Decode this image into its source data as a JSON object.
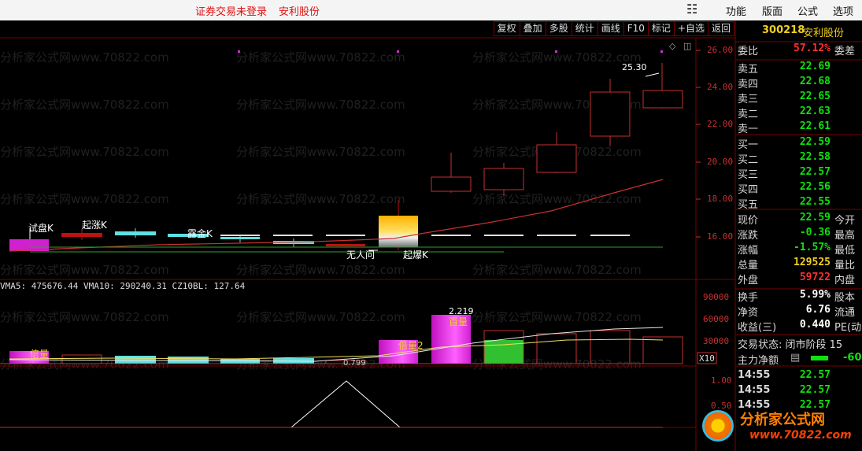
{
  "app": {
    "not_logged": "证券交易未登录",
    "stock_name_top": "安利股份",
    "menus": [
      "功能",
      "版面",
      "公式",
      "选项"
    ]
  },
  "toolbar": [
    "复权",
    "叠加",
    "多股",
    "统计",
    "画线",
    "F10",
    "标记",
    "+自选",
    "返回"
  ],
  "header": {
    "code": "300218",
    "name": "安利股份"
  },
  "watermark": "分析家公式网www.70822.com",
  "price_axis": [
    "26.00",
    "24.00",
    "22.00",
    "20.00",
    "18.00",
    "16.00"
  ],
  "volume_axis": [
    "90000",
    "60000",
    "30000",
    "X10"
  ],
  "osc_axis": [
    "1.00",
    "0.50"
  ],
  "peak_label": "25.30",
  "annotations": {
    "trial": "试盘K",
    "start": "起涨K",
    "wash": "露金K",
    "no_one": "无人问",
    "burst": "起爆K",
    "double1": "倍量",
    "double2": "倍量2",
    "hundred": "百量",
    "vol_val": "2.219",
    "vol_low": "0.799"
  },
  "volume_indicator": "VMA5: 475676.44  VMA10: 290240.31  CZ10BL: 127.64",
  "quote": {
    "wei_bi_label": "委比",
    "wei_bi": "57.12%",
    "wei_cha_label": "委差",
    "sell": [
      {
        "label": "卖五",
        "price": "22.69"
      },
      {
        "label": "卖四",
        "price": "22.68"
      },
      {
        "label": "卖三",
        "price": "22.65"
      },
      {
        "label": "卖二",
        "price": "22.63"
      },
      {
        "label": "卖一",
        "price": "22.61"
      }
    ],
    "buy": [
      {
        "label": "买一",
        "price": "22.59"
      },
      {
        "label": "买二",
        "price": "22.58"
      },
      {
        "label": "买三",
        "price": "22.57"
      },
      {
        "label": "买四",
        "price": "22.56"
      },
      {
        "label": "买五",
        "price": "22.55"
      }
    ],
    "stats": [
      {
        "label": "现价",
        "value": "22.59",
        "right": "今开",
        "color": "green"
      },
      {
        "label": "涨跌",
        "value": "-0.36",
        "right": "最高",
        "color": "green"
      },
      {
        "label": "涨幅",
        "value": "-1.57%",
        "right": "最低",
        "color": "green"
      },
      {
        "label": "总量",
        "value": "129525",
        "right": "量比",
        "color": "yellow"
      },
      {
        "label": "外盘",
        "value": "59722",
        "right": "内盘",
        "color": "red"
      },
      {
        "label": "换手",
        "value": "5.99%",
        "right": "股本",
        "color": "white"
      },
      {
        "label": "净资",
        "value": "6.76",
        "right": "流通",
        "color": "white"
      },
      {
        "label": "收益(三)",
        "value": "0.440",
        "right": "PE(动",
        "color": "white"
      }
    ],
    "trade_status": "交易状态: 闭市阶段 15",
    "main_net": "主力净额",
    "main_net_val": "-60",
    "ticks": [
      {
        "time": "14:55",
        "price": "22.57"
      },
      {
        "time": "14:55",
        "price": "22.57"
      },
      {
        "time": "14:55",
        "price": "22.57"
      }
    ]
  },
  "logo": {
    "name": "分析家公式网",
    "url": "www.70822.com"
  }
}
